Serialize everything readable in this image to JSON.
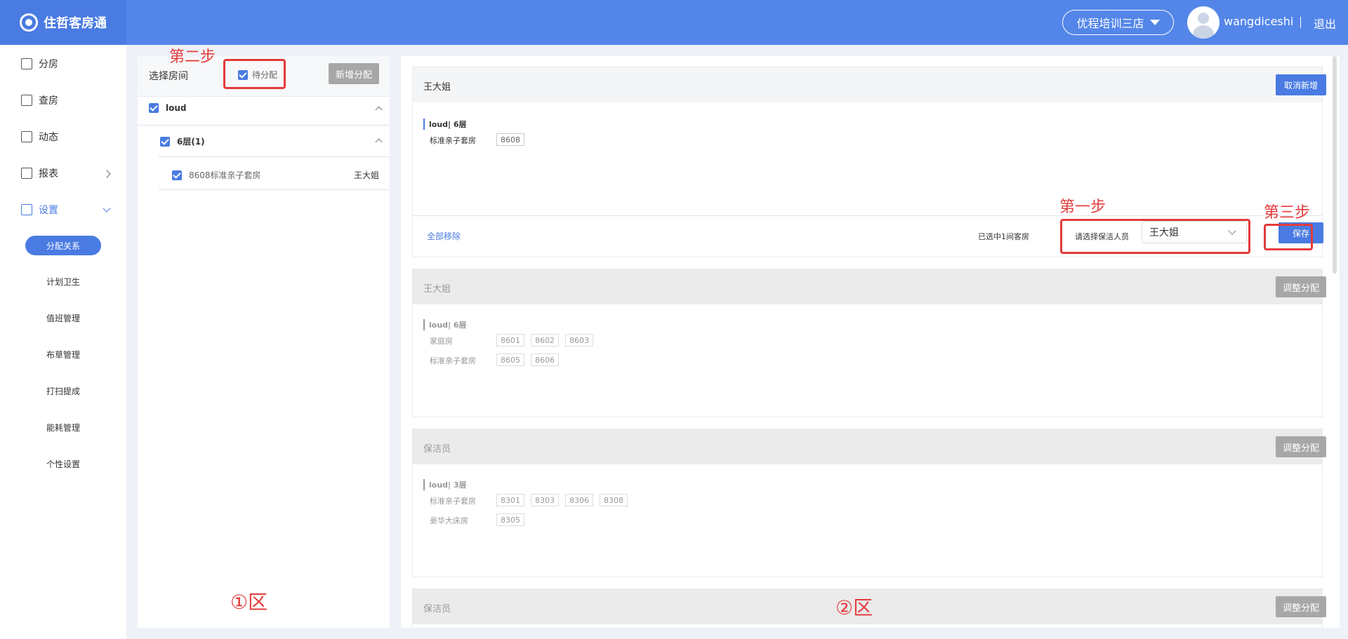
{
  "header": {
    "app_name": "住哲客房通",
    "store": "优程培训三店",
    "username": "wangdiceshi",
    "logout": "退出"
  },
  "sidebar": {
    "items": [
      {
        "label": "分房",
        "icon": "home-icon"
      },
      {
        "label": "查房",
        "icon": "edit-icon"
      },
      {
        "label": "动态",
        "icon": "activity-icon"
      },
      {
        "label": "报表",
        "icon": "chart-icon"
      },
      {
        "label": "设置",
        "icon": "layers-icon"
      }
    ],
    "sub_items": [
      "分配关系",
      "计划卫生",
      "值班管理",
      "布草管理",
      "打扫提成",
      "能耗管理",
      "个性设置"
    ]
  },
  "left_panel": {
    "title": "选择房间",
    "pending_label": "待分配",
    "add_button": "新增分配",
    "tree": {
      "building": "loud",
      "floor": "6层(1)",
      "room": "8608标准亲子套房",
      "room_assignee": "王大姐"
    }
  },
  "cards": [
    {
      "title": "王大姐",
      "button": "取消新增",
      "floor": "loud| 6层",
      "room_types": [
        {
          "label": "标准亲子套房",
          "rooms": [
            "8608"
          ]
        }
      ],
      "remove_all": "全部移除",
      "selected_text": "已选中1间客房",
      "select_label": "请选择保洁人员",
      "select_value": "王大姐",
      "save": "保存"
    },
    {
      "title": "王大姐",
      "button": "调整分配",
      "floor": "loud| 6层",
      "room_types": [
        {
          "label": "家庭房",
          "rooms": [
            "8601",
            "8602",
            "8603"
          ]
        },
        {
          "label": "标准亲子套房",
          "rooms": [
            "8605",
            "8606"
          ]
        }
      ]
    },
    {
      "title": "保洁员",
      "button": "调整分配",
      "floor": "loud| 3层",
      "room_types": [
        {
          "label": "标准亲子套房",
          "rooms": [
            "8301",
            "8303",
            "8306",
            "8308"
          ]
        },
        {
          "label": "豪华大床房",
          "rooms": [
            "8305"
          ]
        }
      ]
    },
    {
      "title": "保洁员",
      "button": "调整分配"
    }
  ],
  "annotations": {
    "step1": "第一步",
    "step2": "第二步",
    "step3": "第三步",
    "zone1": "①区",
    "zone2": "②区"
  },
  "colors": {
    "brand": "#5486e9",
    "accent": "#4a7be3",
    "annotation": "#e43b3b"
  }
}
